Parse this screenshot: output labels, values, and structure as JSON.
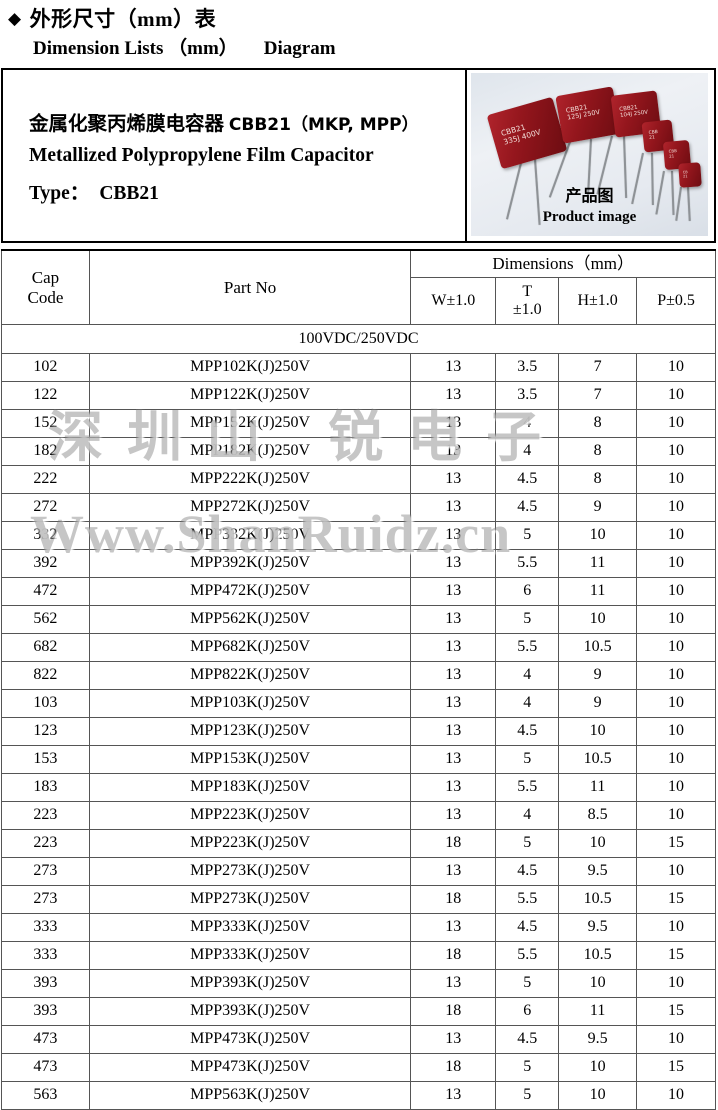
{
  "heading": {
    "bullet": "◆",
    "line1": "外形尺寸（mm）表",
    "line2_a": "Dimension Lists （mm）",
    "line2_b": "Diagram"
  },
  "title_block": {
    "title_cn": "金属化聚丙烯膜电容器",
    "title_model": "CBB21（MKP, MPP）",
    "title_en": "Metallized Polypropylene Film Capacitor",
    "type_label": "Type：",
    "type_value": "CBB21"
  },
  "product_image": {
    "caption_cn": "产品图",
    "caption_en": "Product image",
    "capacitor_labels": [
      {
        "line1": "CBB21",
        "line2": "335J  400V"
      },
      {
        "line1": "CBB21",
        "line2": "125J  250V"
      },
      {
        "line1": "CBB21",
        "line2": "104J  250V"
      },
      {
        "line1": "CBB",
        "line2": "21"
      },
      {
        "line1": "CBB",
        "line2": "21"
      },
      {
        "line1": "CB",
        "line2": "21"
      }
    ]
  },
  "table": {
    "headers": {
      "cap_code_line1": "Cap",
      "cap_code_line2": "Code",
      "part_no": "Part No",
      "dimensions": "Dimensions（mm）",
      "w": "W±1.0",
      "t_line1": "T",
      "t_line2": "±1.0",
      "h": "H±1.0",
      "p": "P±0.5"
    },
    "section_label": "100VDC/250VDC",
    "rows": [
      {
        "cap": "102",
        "part": "MPP102K(J)250V",
        "w": "13",
        "t": "3.5",
        "h": "7",
        "p": "10"
      },
      {
        "cap": "122",
        "part": "MPP122K(J)250V",
        "w": "13",
        "t": "3.5",
        "h": "7",
        "p": "10"
      },
      {
        "cap": "152",
        "part": "MPP152K(J)250V",
        "w": "13",
        "t": "4",
        "h": "8",
        "p": "10"
      },
      {
        "cap": "182",
        "part": "MPP182K(J)250V",
        "w": "13",
        "t": "4",
        "h": "8",
        "p": "10"
      },
      {
        "cap": "222",
        "part": "MPP222K(J)250V",
        "w": "13",
        "t": "4.5",
        "h": "8",
        "p": "10"
      },
      {
        "cap": "272",
        "part": "MPP272K(J)250V",
        "w": "13",
        "t": "4.5",
        "h": "9",
        "p": "10"
      },
      {
        "cap": "332",
        "part": "MPP332K(J)250V",
        "w": "13",
        "t": "5",
        "h": "10",
        "p": "10"
      },
      {
        "cap": "392",
        "part": "MPP392K(J)250V",
        "w": "13",
        "t": "5.5",
        "h": "11",
        "p": "10"
      },
      {
        "cap": "472",
        "part": "MPP472K(J)250V",
        "w": "13",
        "t": "6",
        "h": "11",
        "p": "10"
      },
      {
        "cap": "562",
        "part": "MPP562K(J)250V",
        "w": "13",
        "t": "5",
        "h": "10",
        "p": "10"
      },
      {
        "cap": "682",
        "part": "MPP682K(J)250V",
        "w": "13",
        "t": "5.5",
        "h": "10.5",
        "p": "10"
      },
      {
        "cap": "822",
        "part": "MPP822K(J)250V",
        "w": "13",
        "t": "4",
        "h": "9",
        "p": "10"
      },
      {
        "cap": "103",
        "part": "MPP103K(J)250V",
        "w": "13",
        "t": "4",
        "h": "9",
        "p": "10"
      },
      {
        "cap": "123",
        "part": "MPP123K(J)250V",
        "w": "13",
        "t": "4.5",
        "h": "10",
        "p": "10"
      },
      {
        "cap": "153",
        "part": "MPP153K(J)250V",
        "w": "13",
        "t": "5",
        "h": "10.5",
        "p": "10"
      },
      {
        "cap": "183",
        "part": "MPP183K(J)250V",
        "w": "13",
        "t": "5.5",
        "h": "11",
        "p": "10"
      },
      {
        "cap": "223",
        "part": "MPP223K(J)250V",
        "w": "13",
        "t": "4",
        "h": "8.5",
        "p": "10"
      },
      {
        "cap": "223",
        "part": "MPP223K(J)250V",
        "w": "18",
        "t": "5",
        "h": "10",
        "p": "15"
      },
      {
        "cap": "273",
        "part": "MPP273K(J)250V",
        "w": "13",
        "t": "4.5",
        "h": "9.5",
        "p": "10"
      },
      {
        "cap": "273",
        "part": "MPP273K(J)250V",
        "w": "18",
        "t": "5.5",
        "h": "10.5",
        "p": "15"
      },
      {
        "cap": "333",
        "part": "MPP333K(J)250V",
        "w": "13",
        "t": "4.5",
        "h": "9.5",
        "p": "10"
      },
      {
        "cap": "333",
        "part": "MPP333K(J)250V",
        "w": "18",
        "t": "5.5",
        "h": "10.5",
        "p": "15"
      },
      {
        "cap": "393",
        "part": "MPP393K(J)250V",
        "w": "13",
        "t": "5",
        "h": "10",
        "p": "10"
      },
      {
        "cap": "393",
        "part": "MPP393K(J)250V",
        "w": "18",
        "t": "6",
        "h": "11",
        "p": "15"
      },
      {
        "cap": "473",
        "part": "MPP473K(J)250V",
        "w": "13",
        "t": "4.5",
        "h": "9.5",
        "p": "10"
      },
      {
        "cap": "473",
        "part": "MPP473K(J)250V",
        "w": "18",
        "t": "5",
        "h": "10",
        "p": "15"
      },
      {
        "cap": "563",
        "part": "MPP563K(J)250V",
        "w": "13",
        "t": "5",
        "h": "10",
        "p": "10"
      }
    ]
  },
  "watermarks": {
    "chinese": "深圳山 锐电子",
    "url": "Www.ShanRuidz.cn"
  },
  "colors": {
    "capacitor_red": "#94161d",
    "border": "#000000",
    "watermark": "#787878"
  }
}
